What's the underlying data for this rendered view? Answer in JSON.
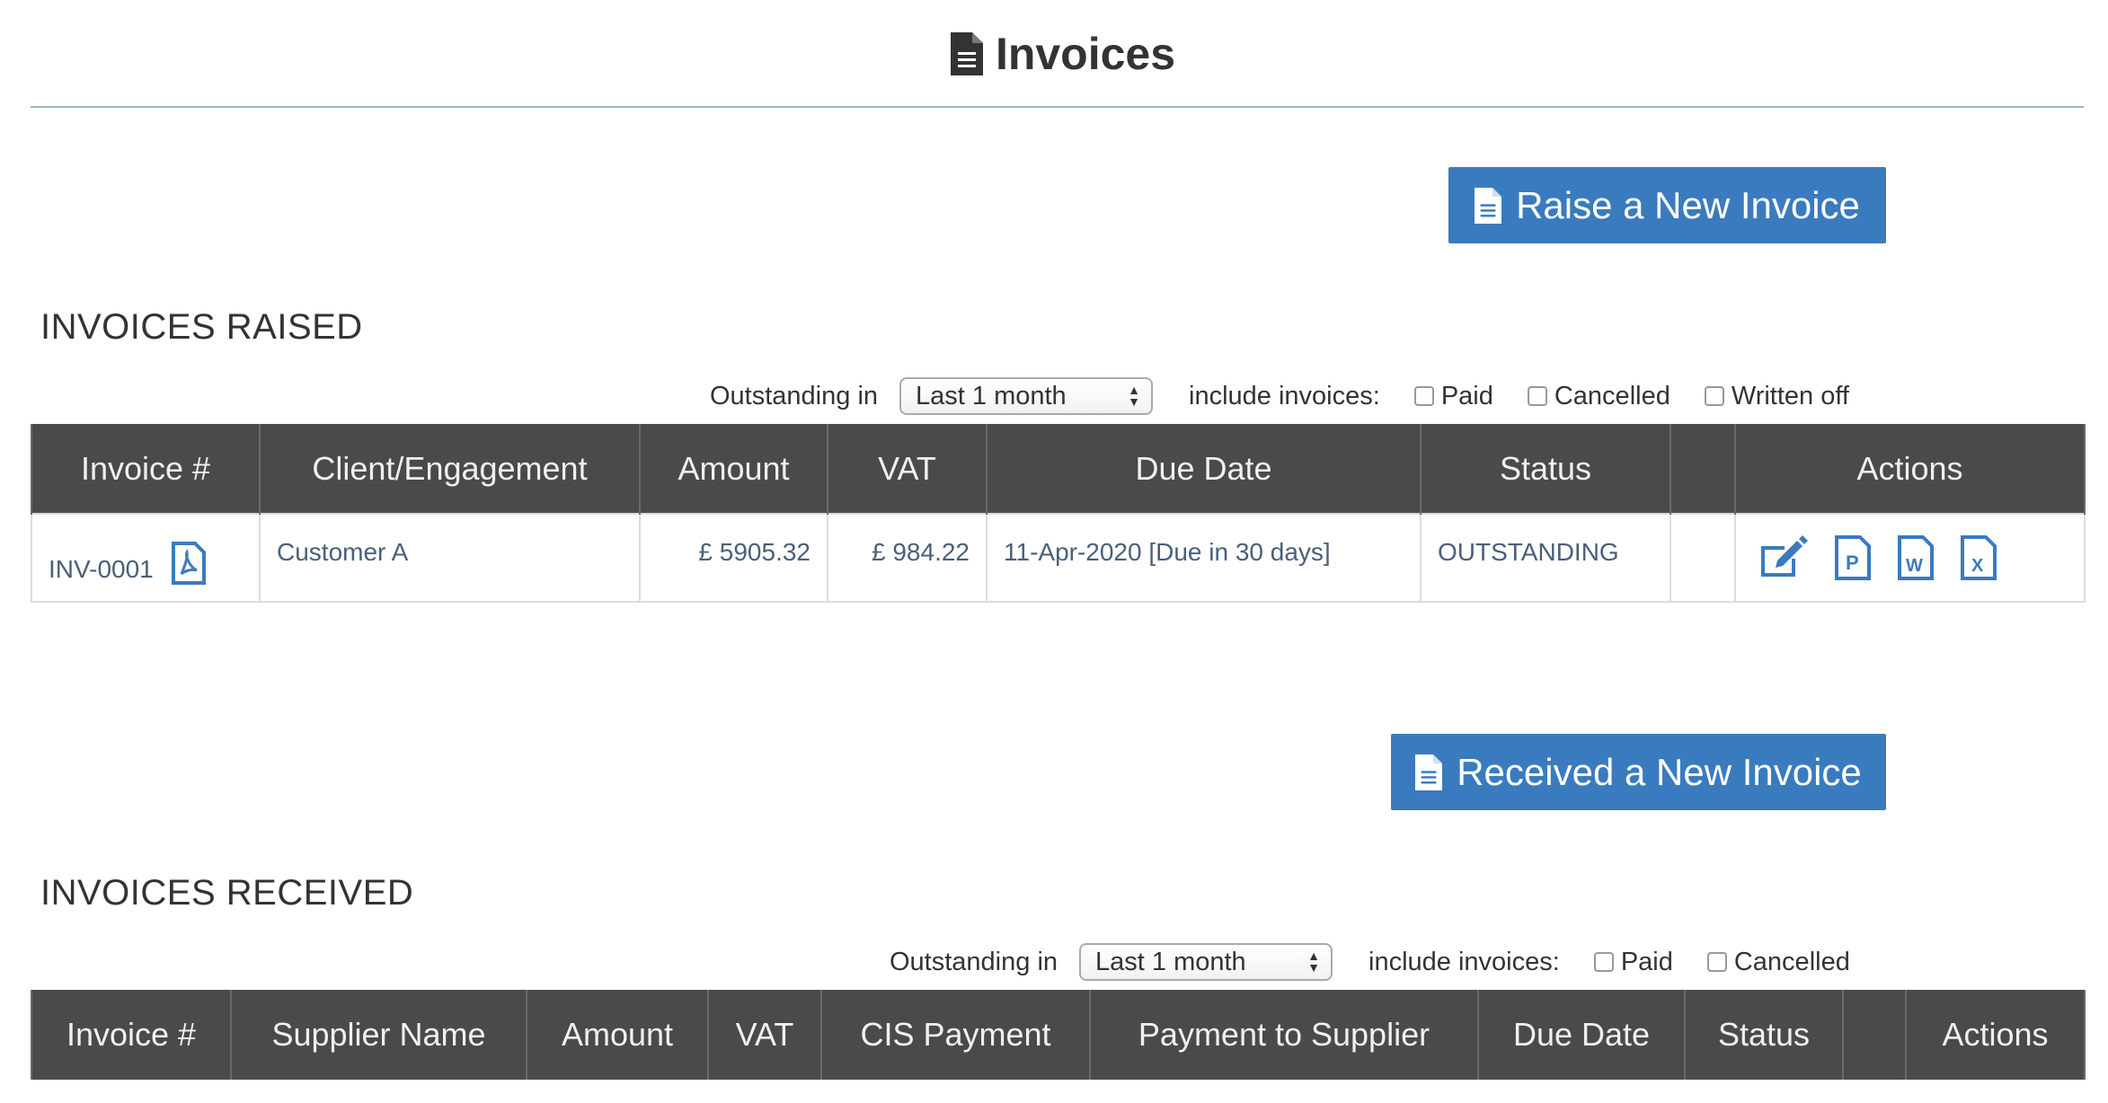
{
  "header": {
    "title": "Invoices"
  },
  "raised": {
    "button_label": "Raise a New Invoice",
    "section_title": "INVOICES RAISED",
    "filter": {
      "outstanding_label": "Outstanding in",
      "select_value": "Last 1 month",
      "include_label": "include invoices:",
      "checkboxes": [
        "Paid",
        "Cancelled",
        "Written off"
      ]
    },
    "columns": [
      "Invoice #",
      "Client/Engagement",
      "Amount",
      "VAT",
      "Due Date",
      "Status",
      "",
      "Actions"
    ],
    "rows": [
      {
        "invoice": "INV-0001",
        "client": "Customer A",
        "amount": "£ 5905.32",
        "vat": "£ 984.22",
        "due": "11-Apr-2020 [Due in 30 days]",
        "status": "OUTSTANDING"
      }
    ],
    "action_icons": [
      "edit-icon",
      "pdf-p-icon",
      "word-icon",
      "excel-icon"
    ]
  },
  "received": {
    "button_label": "Received a New Invoice",
    "section_title": "INVOICES RECEIVED",
    "filter": {
      "outstanding_label": "Outstanding in",
      "select_value": "Last 1 month",
      "include_label": "include invoices:",
      "checkboxes": [
        "Paid",
        "Cancelled"
      ]
    },
    "columns": [
      "Invoice #",
      "Supplier Name",
      "Amount",
      "VAT",
      "CIS Payment",
      "Payment to Supplier",
      "Due Date",
      "Status",
      "",
      "Actions"
    ]
  },
  "colors": {
    "accent": "#3a7bbf",
    "header_bg": "#4a4a4a",
    "link": "#4a5f7a"
  }
}
